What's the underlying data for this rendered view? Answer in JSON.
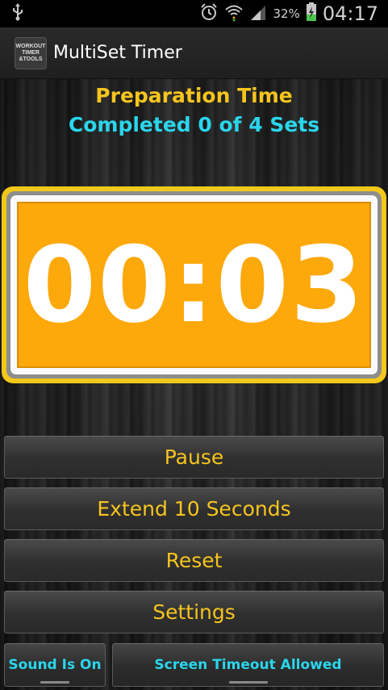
{
  "status_bar": {
    "battery_percent": "32%",
    "time": "04:17",
    "icons": [
      "usb-icon",
      "alarm-icon",
      "wifi-icon",
      "signal-icon",
      "battery-charging-icon"
    ]
  },
  "action_bar": {
    "title": "MultiSet Timer",
    "app_icon_text": [
      "WORKOUT",
      "TIMER",
      "&TOOLS"
    ]
  },
  "timer": {
    "phase": "Preparation Time",
    "sets_status": "Completed 0 of 4 Sets",
    "display": "00:03"
  },
  "buttons": {
    "pause": "Pause",
    "extend": "Extend 10 Seconds",
    "reset": "Reset",
    "settings": "Settings"
  },
  "toggles": {
    "sound": "Sound Is On",
    "screen_timeout": "Screen Timeout Allowed"
  },
  "colors": {
    "accent_yellow": "#f6c41e",
    "accent_cyan": "#2ad6ec",
    "timer_face": "#fda80b"
  }
}
